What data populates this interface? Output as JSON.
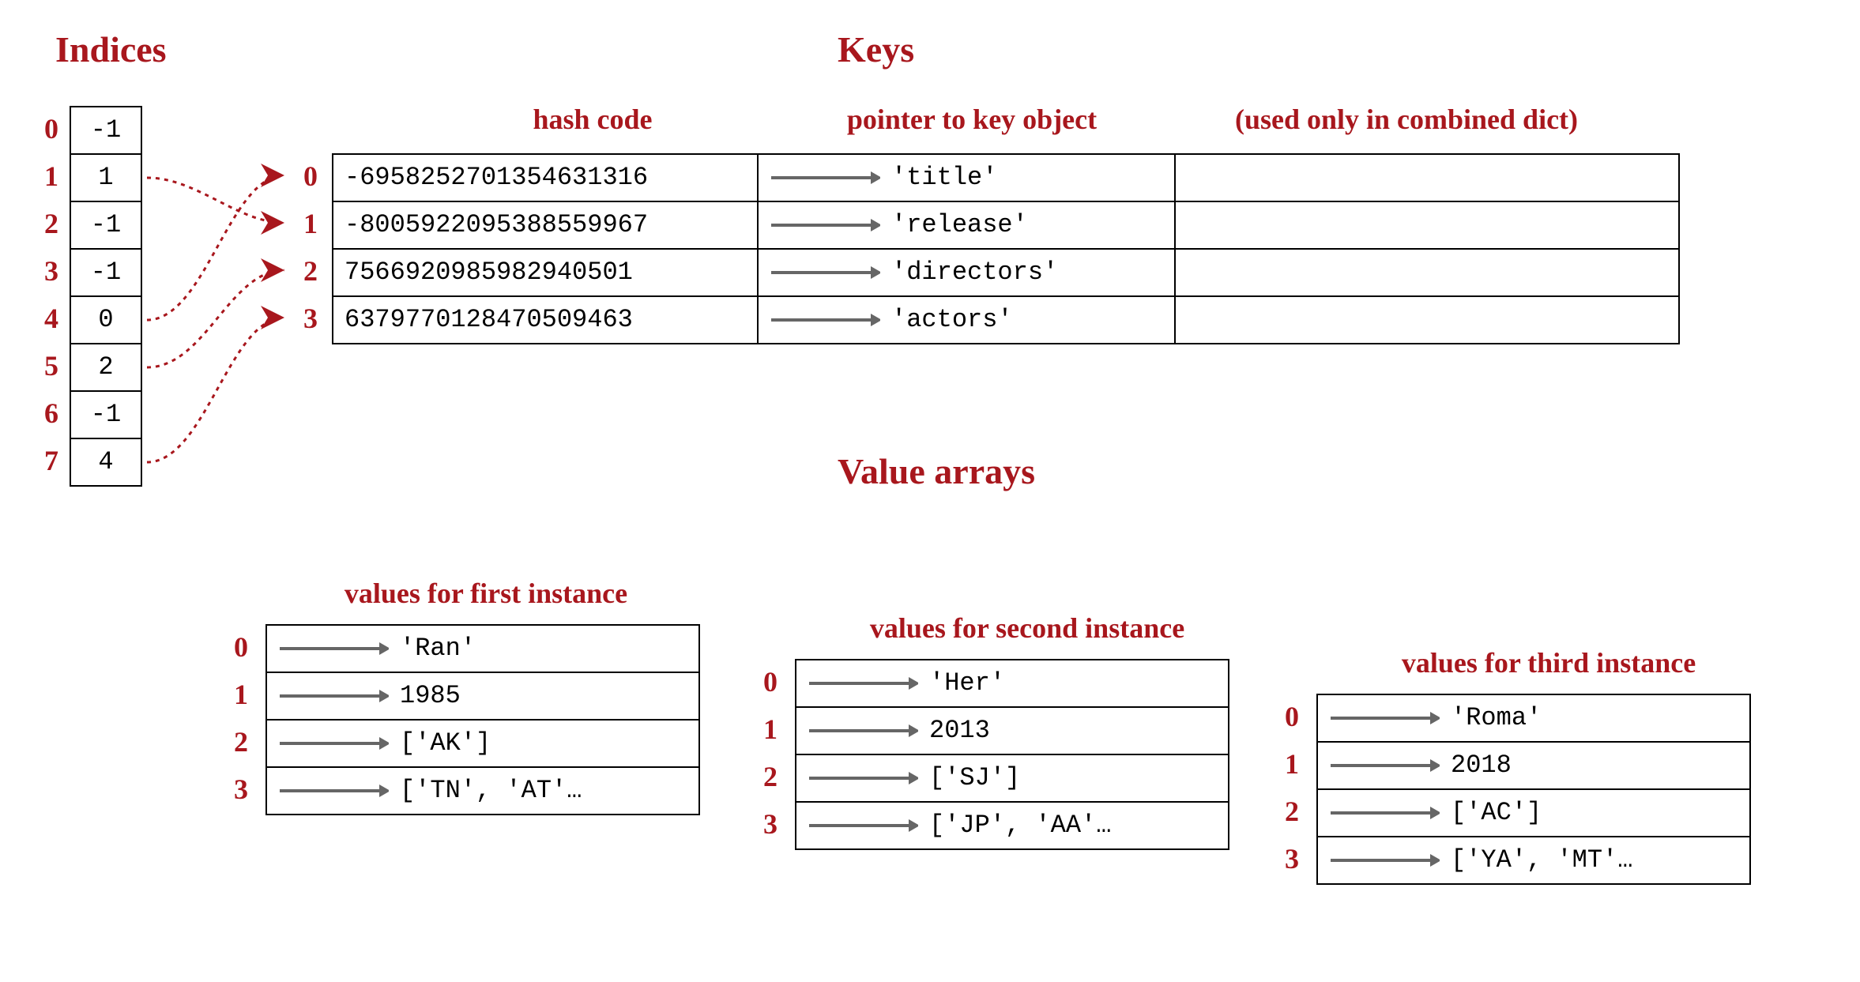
{
  "sections": {
    "indices_title": "Indices",
    "keys_title": "Keys",
    "valuearrays_title": "Value arrays",
    "hash_code_label": "hash code",
    "pointer_label": "pointer to key object",
    "combined_label": "(used only in combined dict)",
    "values_first_label": "values for first instance",
    "values_second_label": "values for second instance",
    "values_third_label": "values for third instance"
  },
  "indices": {
    "labels": [
      "0",
      "1",
      "2",
      "3",
      "4",
      "5",
      "6",
      "7"
    ],
    "values": [
      "-1",
      "1",
      "-1",
      "-1",
      "0",
      "2",
      "-1",
      "4"
    ]
  },
  "keys": {
    "labels": [
      "0",
      "1",
      "2",
      "3"
    ],
    "rows": [
      {
        "hash": "-6958252701354631316",
        "key": "'title'"
      },
      {
        "hash": "-8005922095388559967",
        "key": "'release'"
      },
      {
        "hash": "7566920985982940501",
        "key": "'directors'"
      },
      {
        "hash": "6379770128470509463",
        "key": "'actors'"
      }
    ]
  },
  "values_first": {
    "labels": [
      "0",
      "1",
      "2",
      "3"
    ],
    "rows": [
      "'Ran'",
      "1985",
      "['AK']",
      "['TN', 'AT'…"
    ]
  },
  "values_second": {
    "labels": [
      "0",
      "1",
      "2",
      "3"
    ],
    "rows": [
      "'Her'",
      "2013",
      "['SJ']",
      "['JP', 'AA'…"
    ]
  },
  "values_third": {
    "labels": [
      "0",
      "1",
      "2",
      "3"
    ],
    "rows": [
      "'Roma'",
      "2018",
      "['AC']",
      "['YA', 'MT'…"
    ]
  }
}
